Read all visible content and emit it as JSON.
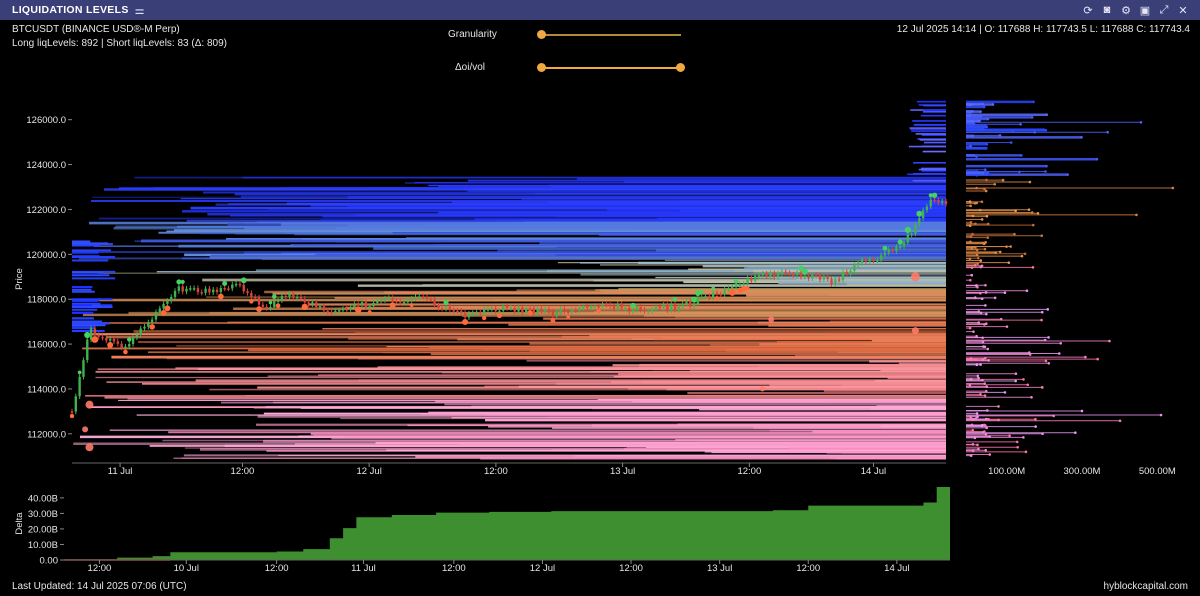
{
  "window": {
    "title": "LIQUIDATION LEVELS",
    "title_icon": "sliders-icon",
    "icons": [
      "refresh-icon",
      "camera-icon",
      "gear-icon",
      "save-icon",
      "expand-icon",
      "close-icon"
    ]
  },
  "header": {
    "symbol": "BTCUSDT (BINANCE USD®-M Perp)",
    "levels": "Long liqLevels: 892 | Short liqLevels: 83 (Δ: 809)",
    "ohlc": "12 Jul 2025 14:14 | O: 117688 H: 117743.5 L: 117688 C: 117743.4"
  },
  "controls": {
    "granularity_label": "Granularity",
    "granularity_value": 0.0,
    "oi_vol_label": "Δoi/vol",
    "oi_vol_range": [
      0.0,
      1.0
    ]
  },
  "footer": {
    "last_updated": "Last Updated: 14 Jul 2025 07:06 (UTC)",
    "brand": "hyblockcapital.com"
  },
  "colors": {
    "short_levels": "#2a3cff",
    "long_levels": "#ff6f8a",
    "mid_levels": "#e07a3a",
    "candle_up": "#3fb34f",
    "candle_down": "#d8443a",
    "delta_fill": "#3d8f2f",
    "titlebar": "#3b3f78"
  },
  "chart_data": [
    {
      "type": "heatmap",
      "ylabel": "Price",
      "y_ticks": [
        112000,
        114000,
        116000,
        118000,
        120000,
        122000,
        124000,
        126000
      ],
      "y_tick_labels": [
        "112000.0",
        "114000.0",
        "116000.0",
        "118000.0",
        "120000.0",
        "122000.0",
        "124000.0",
        "126000.0"
      ],
      "ylim": [
        110700,
        127100
      ],
      "x_tick_labels": [
        "11 Jul",
        "12:00",
        "12 Jul",
        "12:00",
        "13 Jul",
        "12:00",
        "14 Jul"
      ],
      "price_path": [
        {
          "x": 0.0,
          "y": 113000
        },
        {
          "x": 0.02,
          "y": 116600
        },
        {
          "x": 0.06,
          "y": 115900
        },
        {
          "x": 0.09,
          "y": 117100
        },
        {
          "x": 0.12,
          "y": 118500
        },
        {
          "x": 0.16,
          "y": 118300
        },
        {
          "x": 0.19,
          "y": 118700
        },
        {
          "x": 0.22,
          "y": 117600
        },
        {
          "x": 0.25,
          "y": 118200
        },
        {
          "x": 0.3,
          "y": 117400
        },
        {
          "x": 0.35,
          "y": 117900
        },
        {
          "x": 0.4,
          "y": 118000
        },
        {
          "x": 0.45,
          "y": 117300
        },
        {
          "x": 0.5,
          "y": 117600
        },
        {
          "x": 0.55,
          "y": 117400
        },
        {
          "x": 0.6,
          "y": 117800
        },
        {
          "x": 0.65,
          "y": 117500
        },
        {
          "x": 0.7,
          "y": 117700
        },
        {
          "x": 0.74,
          "y": 118300
        },
        {
          "x": 0.78,
          "y": 119000
        },
        {
          "x": 0.82,
          "y": 119200
        },
        {
          "x": 0.87,
          "y": 118800
        },
        {
          "x": 0.9,
          "y": 119600
        },
        {
          "x": 0.95,
          "y": 120300
        },
        {
          "x": 0.98,
          "y": 122400
        },
        {
          "x": 1.0,
          "y": 122300
        }
      ]
    },
    {
      "type": "bar",
      "orientation": "horizontal",
      "x_tick_labels": [
        "100.00M",
        "300.00M",
        "500.00M"
      ],
      "x_ticks": [
        100,
        300,
        500
      ],
      "xlim": [
        0,
        600
      ]
    },
    {
      "type": "area",
      "ylabel": "Delta",
      "y_ticks": [
        0,
        10,
        20,
        30,
        40
      ],
      "y_tick_labels": [
        "0.00",
        "10.00B",
        "20.00B",
        "30.00B",
        "40.00B"
      ],
      "ylim": [
        0,
        47
      ],
      "x_tick_labels": [
        "12:00",
        "10 Jul",
        "12:00",
        "11 Jul",
        "12:00",
        "12 Jul",
        "12:00",
        "13 Jul",
        "12:00",
        "14 Jul"
      ],
      "steps": [
        {
          "x": 0.0,
          "y": 0.5
        },
        {
          "x": 0.06,
          "y": 1.5
        },
        {
          "x": 0.1,
          "y": 2.5
        },
        {
          "x": 0.12,
          "y": 5.0
        },
        {
          "x": 0.24,
          "y": 5.5
        },
        {
          "x": 0.27,
          "y": 7.0
        },
        {
          "x": 0.3,
          "y": 14.0
        },
        {
          "x": 0.315,
          "y": 20.5
        },
        {
          "x": 0.33,
          "y": 27.5
        },
        {
          "x": 0.37,
          "y": 29.0
        },
        {
          "x": 0.42,
          "y": 30.5
        },
        {
          "x": 0.48,
          "y": 31.0
        },
        {
          "x": 0.55,
          "y": 31.5
        },
        {
          "x": 0.65,
          "y": 31.5
        },
        {
          "x": 0.75,
          "y": 31.5
        },
        {
          "x": 0.8,
          "y": 32.0
        },
        {
          "x": 0.84,
          "y": 35.0
        },
        {
          "x": 0.9,
          "y": 35.0
        },
        {
          "x": 0.97,
          "y": 37.0
        },
        {
          "x": 0.985,
          "y": 47.0
        },
        {
          "x": 1.0,
          "y": 47.0
        }
      ]
    }
  ]
}
